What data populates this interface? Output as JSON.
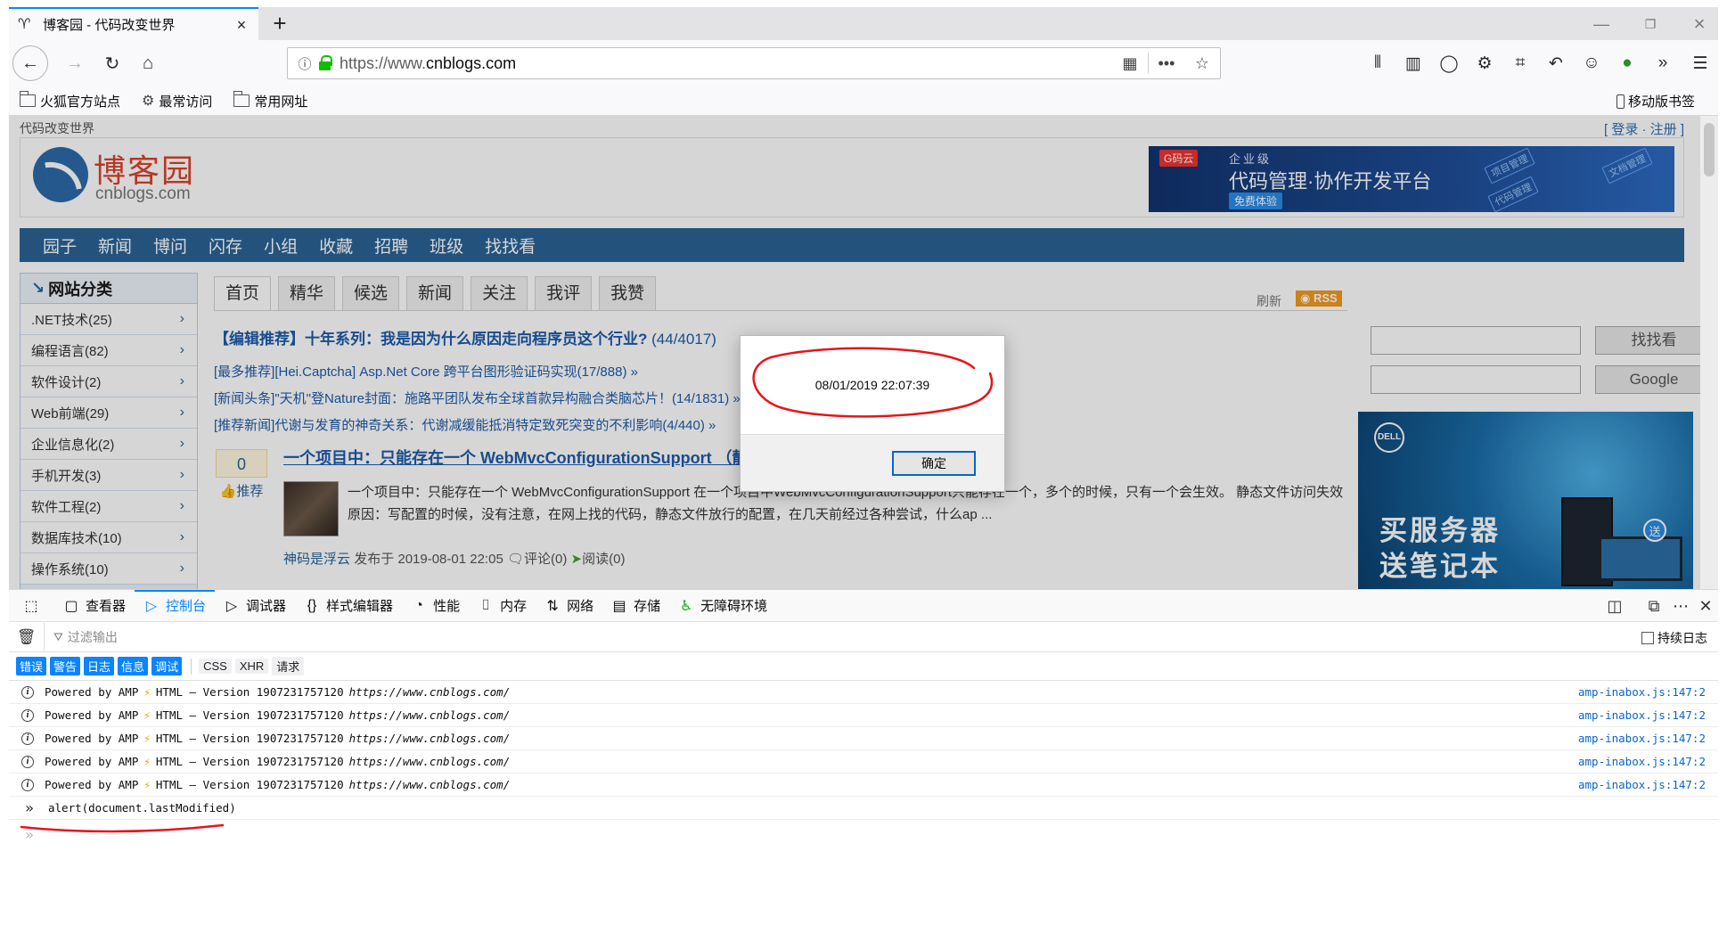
{
  "browser": {
    "tab": {
      "title": "博客园 - 代码改变世界"
    },
    "url": {
      "prefix": "https://www.",
      "domain": "cnblogs.com"
    },
    "bookmarks": [
      {
        "label": "火狐官方站点",
        "icon": "folder-icon"
      },
      {
        "label": "最常访问",
        "icon": "gear-icon"
      },
      {
        "label": "常用网址",
        "icon": "folder-icon"
      }
    ],
    "mobile_bookmarks": "移动版书签"
  },
  "site": {
    "top_left": "代码改变世界",
    "login": "[ 登录 · 注册 ]",
    "logo_cn": "博客园",
    "logo_en": "cnblogs.com",
    "banner": {
      "tag": "G码云",
      "small": "企业级",
      "big": "代码管理·协作开发平台",
      "button": "免费体验",
      "chip1": "项目管理",
      "chip2": "文档管理",
      "chip3": "代码管理"
    },
    "nav": [
      "园子",
      "新闻",
      "博问",
      "闪存",
      "小组",
      "收藏",
      "招聘",
      "班级",
      "找找看"
    ],
    "categories_title": "网站分类",
    "categories": [
      ".NET技术(25)",
      "编程语言(82)",
      "软件设计(2)",
      "Web前端(29)",
      "企业信息化(2)",
      "手机开发(3)",
      "软件工程(2)",
      "数据库技术(10)",
      "操作系统(10)"
    ],
    "tabs": [
      "首页",
      "精华",
      "候选",
      "新闻",
      "关注",
      "我评",
      "我赞"
    ],
    "refresh": "刷新",
    "rss": "RSS",
    "headline": "【编辑推荐】十年系列：我是因为什么原因走向程序员这个行业?",
    "headline_count": "(44/4017)",
    "news": [
      "[最多推荐][Hei.Captcha] Asp.Net Core 跨平台图形验证码实现(17/888) »",
      "[新闻头条]\"天机\"登Nature封面：施路平团队发布全球首款异构融合类脑芯片！(14/1831) »",
      "[推荐新闻]代谢与发育的神奇关系：代谢减缓能抵消特定致死突变的不利影响(4/440) »"
    ],
    "post": {
      "votes": "0",
      "vote_label": "推荐",
      "title": "一个项目中：只能存在一个 WebMvcConfigurationSupport （静态文件失效之坑）",
      "summary": "一个项目中：只能存在一个 WebMvcConfigurationSupport 在一个项目中WebMvcConfigurationSupport只能存在一个，多个的时候，只有一个会生效。 静态文件访问失效原因：写配置的时候，没有注意，在网上找的代码，静态文件放行的配置，在几天前经过各种尝试，什么ap ...",
      "author": "神码是浮云",
      "published": "发布于 2019-08-01 22:05",
      "comments": "评论(0)",
      "reads": "阅读(0)"
    },
    "search_buttons": [
      "找找看",
      "Google"
    ],
    "ad": {
      "line1": "买服务器",
      "line2": "送笔记本",
      "badge": "送",
      "logo": "DELL"
    }
  },
  "alert": {
    "message": "08/01/2019 22:07:39",
    "ok_label": "确定"
  },
  "devtools": {
    "tabs": [
      {
        "label": "查看器",
        "icon": "inspector-icon"
      },
      {
        "label": "控制台",
        "icon": "console-icon",
        "active": true
      },
      {
        "label": "调试器",
        "icon": "debugger-icon"
      },
      {
        "label": "样式编辑器",
        "icon": "braces-icon"
      },
      {
        "label": "性能",
        "icon": "gauge-icon"
      },
      {
        "label": "内存",
        "icon": "memory-icon"
      },
      {
        "label": "网络",
        "icon": "network-icon"
      },
      {
        "label": "存储",
        "icon": "storage-icon"
      },
      {
        "label": "无障碍环境",
        "icon": "accessibility-icon"
      }
    ],
    "filter_placeholder": "过滤输出",
    "persist_logs": "持续日志",
    "levels": [
      "错误",
      "警告",
      "日志",
      "信息",
      "调试"
    ],
    "types": [
      "CSS",
      "XHR",
      "请求"
    ],
    "messages": [
      {
        "text": "Powered by AMP",
        "suffix": "HTML – Version 1907231757120",
        "url": "https://www.cnblogs.com/",
        "source": "amp-inabox.js:147:2"
      },
      {
        "text": "Powered by AMP",
        "suffix": "HTML – Version 1907231757120",
        "url": "https://www.cnblogs.com/",
        "source": "amp-inabox.js:147:2"
      },
      {
        "text": "Powered by AMP",
        "suffix": "HTML – Version 1907231757120",
        "url": "https://www.cnblogs.com/",
        "source": "amp-inabox.js:147:2"
      },
      {
        "text": "Powered by AMP",
        "suffix": "HTML – Version 1907231757120",
        "url": "https://www.cnblogs.com/",
        "source": "amp-inabox.js:147:2"
      },
      {
        "text": "Powered by AMP",
        "suffix": "HTML – Version 1907231757120",
        "url": "https://www.cnblogs.com/",
        "source": "amp-inabox.js:147:2"
      }
    ],
    "input_command": "alert(document.lastModified)"
  },
  "colors": {
    "accent": "#0a84ff",
    "site_nav": "#2a6496",
    "annotation": "#e8141b"
  }
}
